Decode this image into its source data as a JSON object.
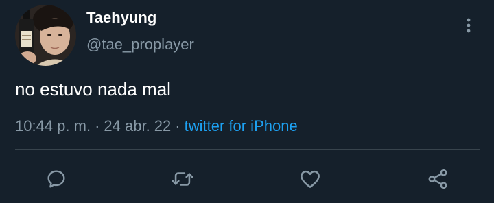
{
  "tweet": {
    "display_name": "Taehyung",
    "handle": "@tae_proplayer",
    "text": "no estuvo nada mal",
    "time": "10:44 p. m.",
    "separator": "·",
    "date": "24 abr. 22",
    "source": "twitter for iPhone"
  },
  "icons": {
    "more": "more-vertical-icon",
    "reply": "reply-icon",
    "retweet": "retweet-icon",
    "like": "heart-icon",
    "share": "share-icon"
  },
  "colors": {
    "background": "#15202b",
    "primary_text": "#ffffff",
    "secondary_text": "#8899a6",
    "link": "#1da1f2",
    "divider": "#38444d"
  }
}
